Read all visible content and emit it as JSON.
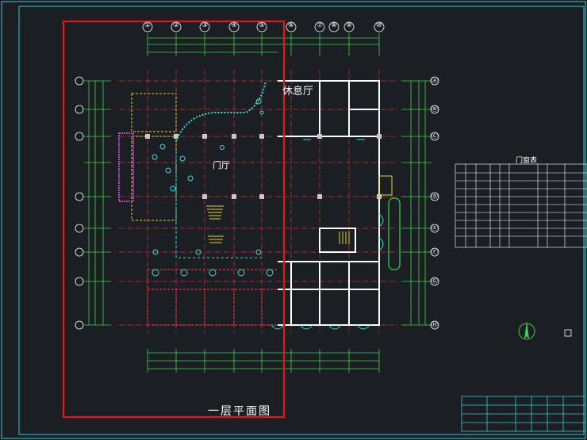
{
  "labels": {
    "lounge": "休息厅",
    "hall": "门厅",
    "door_schedule": "门窗表",
    "floor_plan_title": "一层平面图"
  },
  "grid": {
    "top": [
      "①",
      "②",
      "③",
      "④",
      "⑤",
      "⑥",
      "⑦",
      "⑧",
      "⑨",
      "⑩"
    ],
    "right": [
      "Ⓐ",
      "Ⓑ",
      "Ⓒ",
      "Ⓓ",
      "Ⓔ",
      "Ⓕ",
      "Ⓖ",
      "Ⓗ"
    ]
  },
  "colors": {
    "background": "#1b1f24",
    "frame": "#39c7d0",
    "wall": "#ffffff",
    "axis": "#e0323c",
    "dimension": "#3cd44a",
    "furniture": "#3fd9d4",
    "highlight": "#e01818",
    "yellow": "#e7d23a",
    "magenta": "#b04fc0"
  }
}
